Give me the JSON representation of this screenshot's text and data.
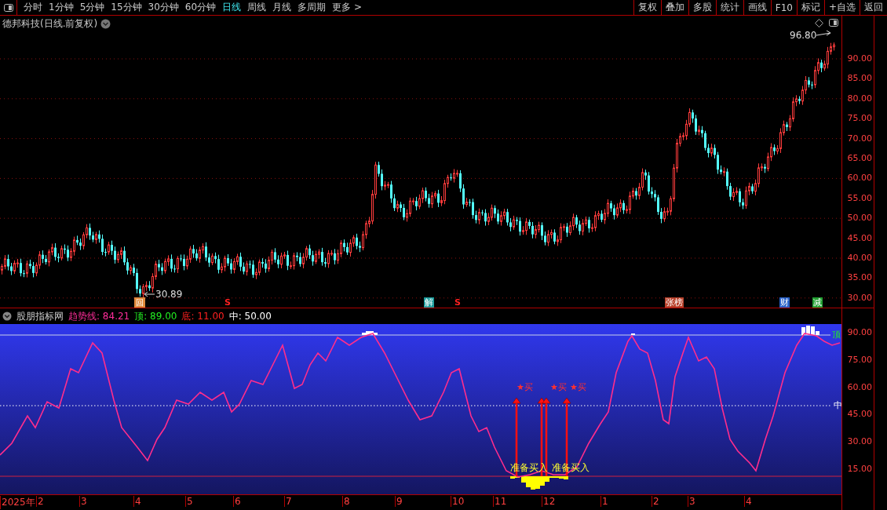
{
  "toolbar": {
    "periods": [
      {
        "label": "分时",
        "selected": false
      },
      {
        "label": "1分钟",
        "selected": false
      },
      {
        "label": "5分钟",
        "selected": false
      },
      {
        "label": "15分钟",
        "selected": false
      },
      {
        "label": "30分钟",
        "selected": false
      },
      {
        "label": "60分钟",
        "selected": false
      },
      {
        "label": "日线",
        "selected": true
      },
      {
        "label": "周线",
        "selected": false
      },
      {
        "label": "月线",
        "selected": false
      },
      {
        "label": "多周期",
        "selected": false
      },
      {
        "label": "更多 >",
        "selected": false
      }
    ],
    "actions": [
      "复权",
      "叠加",
      "多股",
      "统计",
      "画线",
      "F10",
      "标记",
      "+自选",
      "返回"
    ]
  },
  "main_chart": {
    "title": "德邦科技(日线.前复权)",
    "high_label": "96.80",
    "low_label": "30.89",
    "y_ticks": [
      "90.00",
      "85.00",
      "80.00",
      "75.00",
      "70.00",
      "65.00",
      "60.00",
      "55.00",
      "50.00",
      "45.00",
      "40.00",
      "35.00",
      "30.00"
    ],
    "events": [
      {
        "label": "回",
        "kind": "outlined",
        "color": "#e08a3c"
      },
      {
        "label": "S",
        "kind": "text",
        "color": "#ff2020"
      },
      {
        "label": "解",
        "kind": "filled",
        "color": "#1c9c9c"
      },
      {
        "label": "S",
        "kind": "text",
        "color": "#ff2020"
      },
      {
        "label": "张榜",
        "kind": "filled",
        "color": "#b8402a"
      },
      {
        "label": "财",
        "kind": "filled",
        "color": "#2a62c8"
      },
      {
        "label": "减",
        "kind": "filled",
        "color": "#22a032"
      }
    ]
  },
  "indicator": {
    "name": "股朋指标网",
    "legend": [
      {
        "label": "趋势线: 84.21",
        "kind": "trend"
      },
      {
        "label": "顶: 89.00",
        "kind": "top"
      },
      {
        "label": "底: 11.00",
        "kind": "bottom"
      },
      {
        "label": "中: 50.00",
        "kind": "middle"
      }
    ],
    "y_ticks": [
      "90.00",
      "75.00",
      "60.00",
      "45.00",
      "30.00",
      "15.00"
    ],
    "top_tag": "顶",
    "mid_tag": "中",
    "buy_marks": [
      "★买",
      "★买",
      "★买"
    ],
    "prepare_marks": [
      "准备买入",
      "准备买入"
    ]
  },
  "x_axis": [
    "2025年",
    "2",
    "3",
    "4",
    "5",
    "6",
    "7",
    "8",
    "9",
    "10",
    "11",
    "12",
    "1",
    "2",
    "3",
    "4"
  ]
}
